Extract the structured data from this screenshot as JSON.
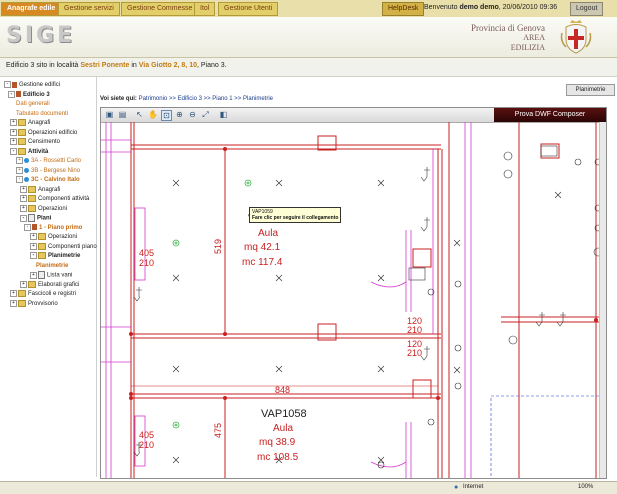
{
  "topnav": {
    "tabs": [
      {
        "label": "Anagrafe edile",
        "active": true
      },
      {
        "label": "Gestione servizi",
        "active": false
      },
      {
        "label": "Gestione Commesse",
        "active": false
      },
      {
        "label": "Itol",
        "active": false
      },
      {
        "label": "Gestione Utenti",
        "active": false
      }
    ],
    "helpdesk": "HelpDesk",
    "welcome_prefix": "Benvenuto",
    "user": "demo demo",
    "datetime": ", 20/06/2010 09:36",
    "logout": "Logout"
  },
  "header": {
    "logo": "SIGE",
    "province": "Provincia di Genova",
    "area": "AREA",
    "dept": "EDILIZIA"
  },
  "location": {
    "prefix": "Edificio",
    "building": "3",
    "mid": "sito in località",
    "place": "Sestri Ponente",
    "in": "in",
    "street": "Via Giotto 2, 8, 10",
    "floor": ", Piano 3."
  },
  "tree": {
    "collapse_glyph": "◂",
    "items": [
      {
        "label": "Gestione edifici",
        "pm": "-",
        "icon": "bi",
        "style": ""
      },
      {
        "label": "Edificio 3",
        "pm": "-",
        "icon": "bi",
        "style": "bold"
      },
      {
        "label": "Dati generali",
        "pm": "",
        "icon": "",
        "style": "orange"
      },
      {
        "label": "Tabulato documenti",
        "pm": "",
        "icon": "",
        "style": "orange"
      },
      {
        "label": "Anagrafi",
        "pm": "+",
        "icon": "fi",
        "style": ""
      },
      {
        "label": "Operazioni edificio",
        "pm": "+",
        "icon": "fi",
        "style": ""
      },
      {
        "label": "Censimento",
        "pm": "+",
        "icon": "fi",
        "style": ""
      },
      {
        "label": "Attività",
        "pm": "-",
        "icon": "fi",
        "style": "bold"
      },
      {
        "label": "3A - Rossetti Carlo",
        "pm": "+",
        "icon": "ri",
        "style": "orange"
      },
      {
        "label": "3B - Bergese Nino",
        "pm": "+",
        "icon": "ri",
        "style": "orange"
      },
      {
        "label": "3C - Calvino Italo",
        "pm": "-",
        "icon": "ri",
        "style": "orange-b"
      },
      {
        "label": "Anagrafi",
        "pm": "+",
        "icon": "fi",
        "style": ""
      },
      {
        "label": "Componenti attività",
        "pm": "+",
        "icon": "fi",
        "style": ""
      },
      {
        "label": "Operazioni",
        "pm": "+",
        "icon": "fi",
        "style": ""
      },
      {
        "label": "Piani",
        "pm": "-",
        "icon": "di",
        "style": "bold"
      },
      {
        "label": "1 - Piano primo",
        "pm": "-",
        "icon": "bi",
        "style": "orange-b"
      },
      {
        "label": "Operazioni",
        "pm": "+",
        "icon": "fi",
        "style": ""
      },
      {
        "label": "Componenti piano",
        "pm": "+",
        "icon": "fi",
        "style": ""
      },
      {
        "label": "Planimetrie",
        "pm": "-",
        "icon": "fi",
        "style": "bold"
      },
      {
        "label": "Planimetrie",
        "pm": "",
        "icon": "",
        "style": "orange-b"
      },
      {
        "label": "Lista vani",
        "pm": "+",
        "icon": "di",
        "style": ""
      },
      {
        "label": "Elaborati grafici",
        "pm": "+",
        "icon": "fi",
        "style": ""
      },
      {
        "label": "Fascicoli e registri",
        "pm": "+",
        "icon": "fi",
        "style": ""
      },
      {
        "label": "Provvisorio",
        "pm": "+",
        "icon": "fi",
        "style": ""
      }
    ]
  },
  "main": {
    "plan_button": "Planimetrie",
    "breadcrumb_label": "Voi siete qui:",
    "breadcrumb_path": "Patrimonio >> Edificio 3 >> Piano 1 >> Planimetrie"
  },
  "viewer": {
    "brand": "Prova DWF Composer",
    "toolbar_icons": [
      "save-icon",
      "print-icon",
      "pointer-icon",
      "pan-icon",
      "zoom-window-icon",
      "zoom-in-icon",
      "zoom-out-icon",
      "fit-icon",
      "layers-icon"
    ],
    "tooltip_id": "VAP1059",
    "tooltip_text": "Fare clic per seguire il collegamento",
    "rooms": [
      {
        "id": "VAP1059",
        "use": "Aula",
        "area": "mq  42.1",
        "volume": "mc  117.4"
      },
      {
        "id": "VAP1058",
        "use": "Aula",
        "area": "mq  38.9",
        "volume": "mc  108.5"
      }
    ],
    "dimensions": [
      "405",
      "210",
      "519",
      "405",
      "210",
      "120",
      "210",
      "120",
      "210",
      "848",
      "475"
    ]
  },
  "statusbar": {
    "zone": "Internet",
    "zoom": "100%"
  },
  "colors": {
    "accent_tab": "#d88a22",
    "plan_red": "#c92020",
    "plan_magenta": "#d23ad2",
    "plan_green": "#3cb44b"
  }
}
